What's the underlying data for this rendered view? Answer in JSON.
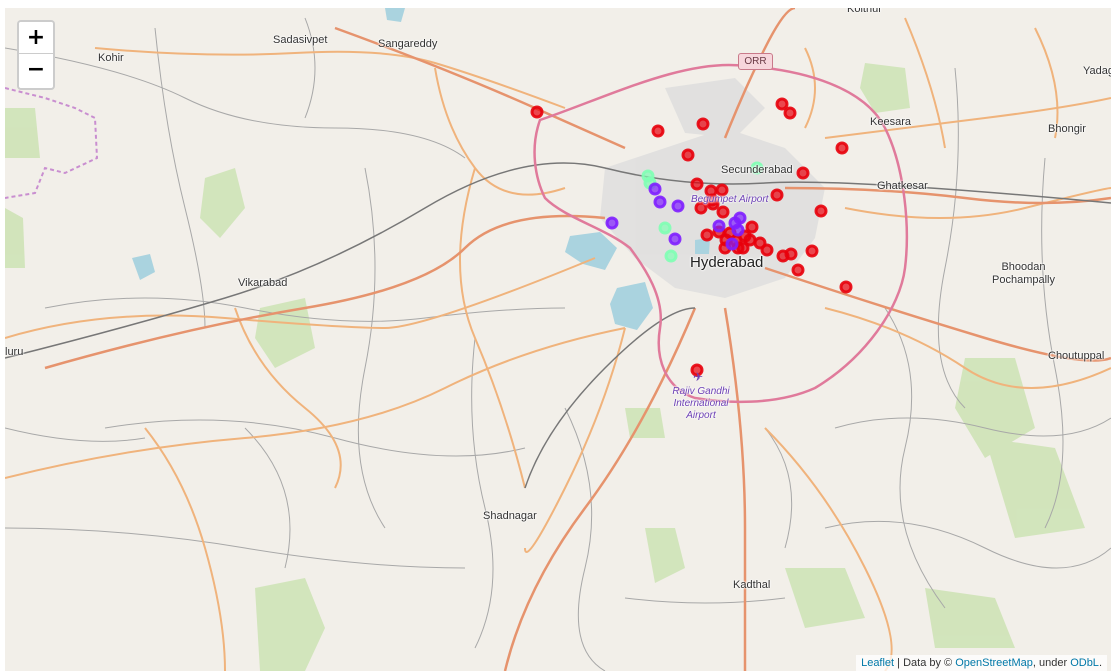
{
  "map": {
    "zoom_in_label": "+",
    "zoom_out_label": "−",
    "shield_label": "ORR",
    "places": {
      "kohir": "Kohir",
      "sadasivpet": "Sadasivpet",
      "sangareddy": "Sangareddy",
      "kolthur": "Kolthur",
      "yadagirigutta": "Yadag",
      "keesara": "Keesara",
      "bhongir": "Bhongir",
      "secunderabad": "Secunderabad",
      "ghatkesar": "Ghatkesar",
      "begumpet": "Begumpet Airport",
      "hyderabad": "Hyderabad",
      "vikarabad": "Vikarabad",
      "bhoodan_pochampally": "Bhoodan Pochampally",
      "choutuppal": "Choutuppal",
      "tanduru": "luru",
      "airport_line1": "Rajiv Gandhi",
      "airport_line2": "International",
      "airport_line3": "Airport",
      "shadnagar": "Shadnagar",
      "kadthal": "Kadthal"
    }
  },
  "markers": {
    "colors": {
      "red": "#e8000b",
      "purple": "#7f1fff",
      "green": "#80ffb4"
    },
    "red_count": 36,
    "purple_count": 10,
    "green_count": 5
  },
  "attribution": {
    "leaflet": "Leaflet",
    "separator": " | Data by © ",
    "osm": "OpenStreetMap",
    "under": ", under ",
    "odbl": "ODbL",
    "end": "."
  }
}
